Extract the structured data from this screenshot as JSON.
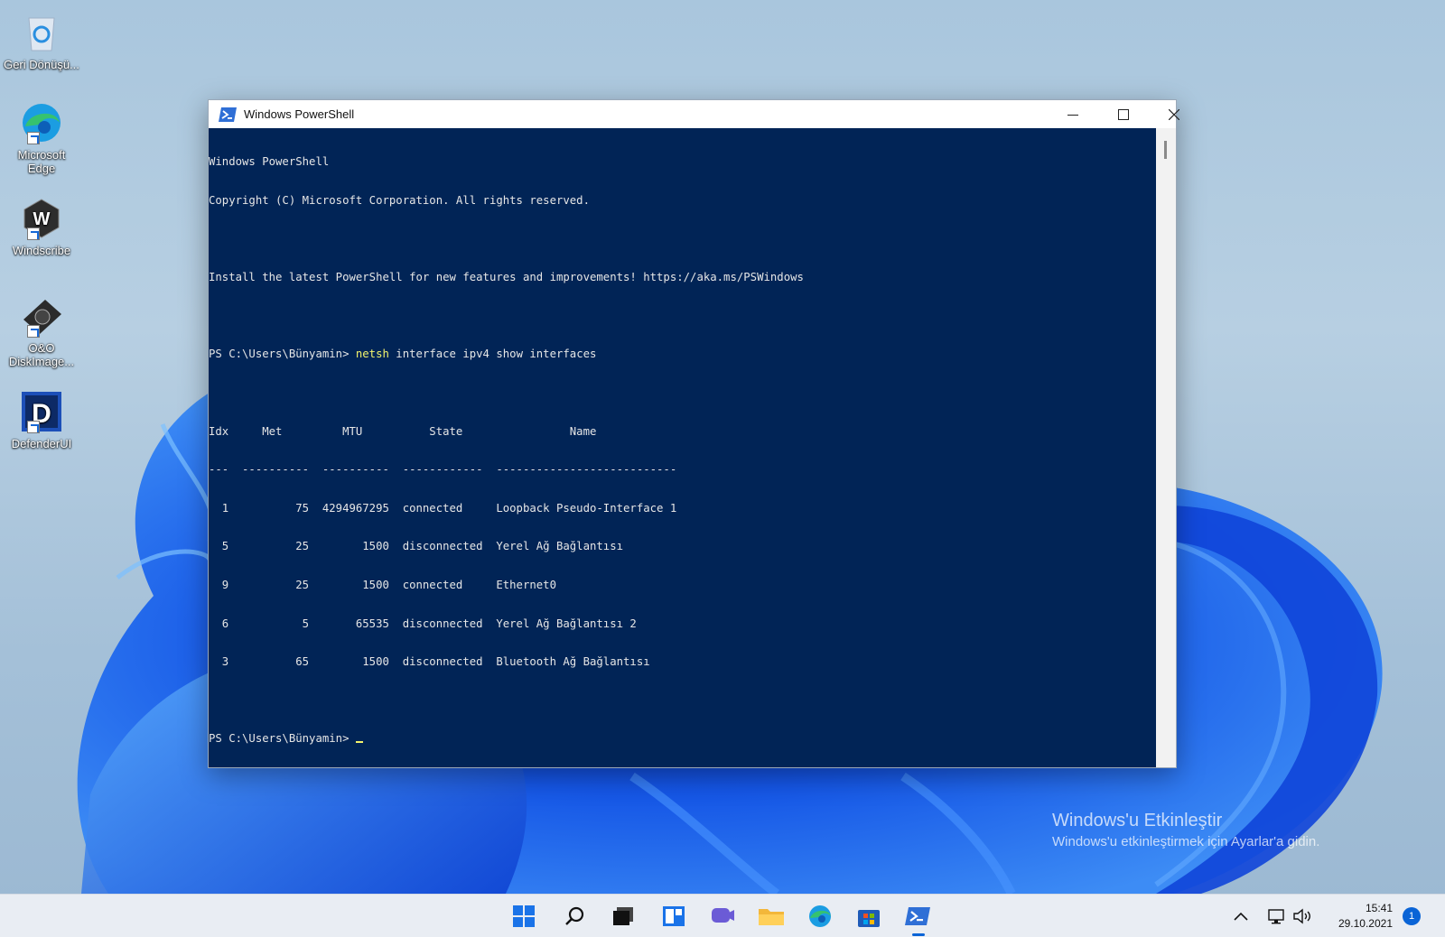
{
  "desktop": {
    "icons": [
      {
        "label": "Geri Dönüşü..."
      },
      {
        "label": "Microsoft Edge"
      },
      {
        "label": "Windscribe"
      },
      {
        "label": "O&O DiskImage..."
      },
      {
        "label": "DefenderUI"
      }
    ]
  },
  "window": {
    "title": "Windows PowerShell",
    "minimize_label": "—",
    "maximize_label": "☐",
    "close_label": "✕"
  },
  "console": {
    "banner1": "Windows PowerShell",
    "banner2": "Copyright (C) Microsoft Corporation. All rights reserved.",
    "install_msg": "Install the latest PowerShell for new features and improvements! https://aka.ms/PSWindows",
    "prompt": "PS C:\\Users\\Bünyamin> ",
    "command_keyword": "netsh",
    "command_rest": " interface ipv4 show interfaces",
    "table_header": "Idx     Met         MTU          State                Name",
    "table_sep": "---  ----------  ----------  ------------  ---------------------------",
    "rows": [
      "  1          75  4294967295  connected     Loopback Pseudo-Interface 1",
      "  5          25        1500  disconnected  Yerel Ağ Bağlantısı",
      "  9          25        1500  connected     Ethernet0",
      "  6           5       65535  disconnected  Yerel Ağ Bağlantısı 2",
      "  3          65        1500  disconnected  Bluetooth Ağ Bağlantısı"
    ],
    "final_prompt": "PS C:\\Users\\Bünyamin> "
  },
  "watermark": {
    "title": "Windows'u Etkinleştir",
    "subtitle": "Windows'u etkinleştirmek için Ayarlar'a gidin."
  },
  "taskbar": {
    "icons": [
      "start-icon",
      "search-icon",
      "task-view-icon",
      "widgets-icon",
      "chat-icon",
      "file-explorer-icon",
      "edge-icon",
      "store-icon",
      "powershell-icon"
    ],
    "time": "15:41",
    "date": "29.10.2021",
    "notification_count": "1"
  },
  "colors": {
    "console_bg": "#012456",
    "console_text": "#e6e6e6",
    "command_highlight": "#f3f36c",
    "accent": "#0a64d6"
  }
}
